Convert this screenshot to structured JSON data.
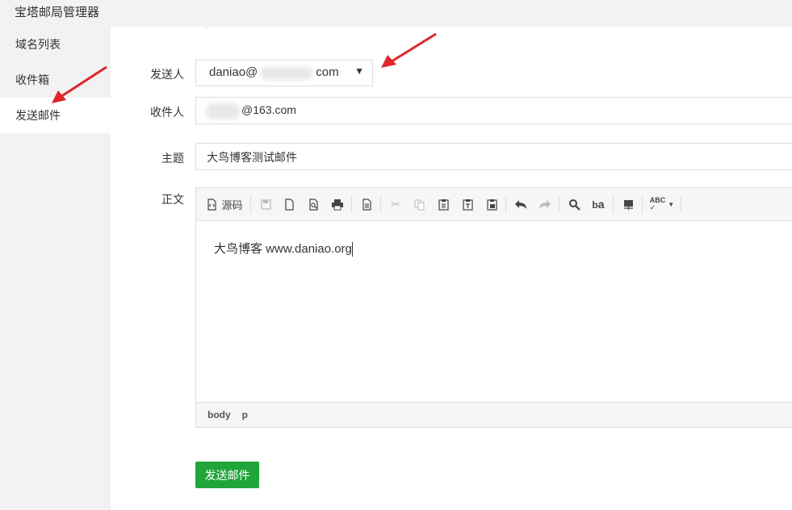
{
  "app": {
    "title": "宝塔邮局管理器"
  },
  "sidebar": {
    "items": [
      {
        "label": "域名列表"
      },
      {
        "label": "收件箱"
      },
      {
        "label": "发送邮件",
        "active": true
      }
    ]
  },
  "form": {
    "sender": {
      "label": "发送人",
      "value_prefix": "daniao@",
      "value_suffix": "com"
    },
    "recipient": {
      "label": "收件人",
      "value": "@163.com"
    },
    "subject": {
      "label": "主题",
      "value": "大鸟博客测试邮件"
    },
    "body": {
      "label": "正文"
    }
  },
  "editor": {
    "toolbar": {
      "source_label": "源码"
    },
    "content": "大鸟博客 www.daniao.org",
    "status": [
      "body",
      "p"
    ]
  },
  "actions": {
    "send_label": "发送邮件"
  },
  "colors": {
    "accent": "#20a53a",
    "annotation": "#e0262a"
  }
}
